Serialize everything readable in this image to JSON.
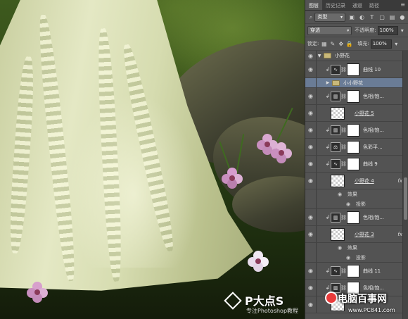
{
  "panel": {
    "tabs": [
      "图层",
      "历史记录",
      "通道",
      "路径"
    ],
    "menu_icon": "panel-menu-icon",
    "filter": {
      "kind_label": "类型",
      "icons": [
        "image-filter-icon",
        "adjustment-filter-icon",
        "type-filter-icon",
        "shape-filter-icon",
        "smart-object-filter-icon",
        "filter-toggle-icon"
      ]
    },
    "blend": {
      "mode": "穿透",
      "opacity_label": "不透明度:",
      "opacity": "100%"
    },
    "lock": {
      "label": "锁定:",
      "fill_label": "填充:",
      "fill": "100%"
    },
    "layers": [
      {
        "kind": "group",
        "name": "小野花"
      },
      {
        "kind": "adjust",
        "icon": "curves",
        "name": "曲线 10",
        "clip": true
      },
      {
        "kind": "subgroup",
        "name": "小小野花",
        "selected": true
      },
      {
        "kind": "adjust",
        "icon": "hue",
        "name": "色相/饱...",
        "clip": true
      },
      {
        "kind": "pixel",
        "name": "小野花 5"
      },
      {
        "kind": "adjust",
        "icon": "hue",
        "name": "色相/饱...",
        "clip": true
      },
      {
        "kind": "adjust",
        "icon": "balance",
        "name": "色彩平...",
        "clip": true
      },
      {
        "kind": "adjust",
        "icon": "curves",
        "name": "曲线 9",
        "clip": true
      },
      {
        "kind": "pixel",
        "name": "小野花 4",
        "fx": "fx"
      },
      {
        "kind": "effect-label",
        "name": "效果"
      },
      {
        "kind": "effect",
        "name": "投影"
      },
      {
        "kind": "adjust",
        "icon": "hue",
        "name": "色相/饱...",
        "clip": true
      },
      {
        "kind": "pixel",
        "name": "小野花 3",
        "fx": "fx"
      },
      {
        "kind": "effect-label",
        "name": "效果"
      },
      {
        "kind": "effect",
        "name": "投影"
      },
      {
        "kind": "adjust",
        "icon": "curves",
        "name": "曲线 11",
        "clip": true
      },
      {
        "kind": "adjust",
        "icon": "hue",
        "name": "色相/饱...",
        "clip": true
      },
      {
        "kind": "pixel",
        "name": ""
      }
    ]
  },
  "watermark_left": {
    "title": "P大点S",
    "subtitle": "专注Photoshop教程"
  },
  "watermark_right": {
    "title": "电脑百事网",
    "url": "www.PC841.com"
  }
}
